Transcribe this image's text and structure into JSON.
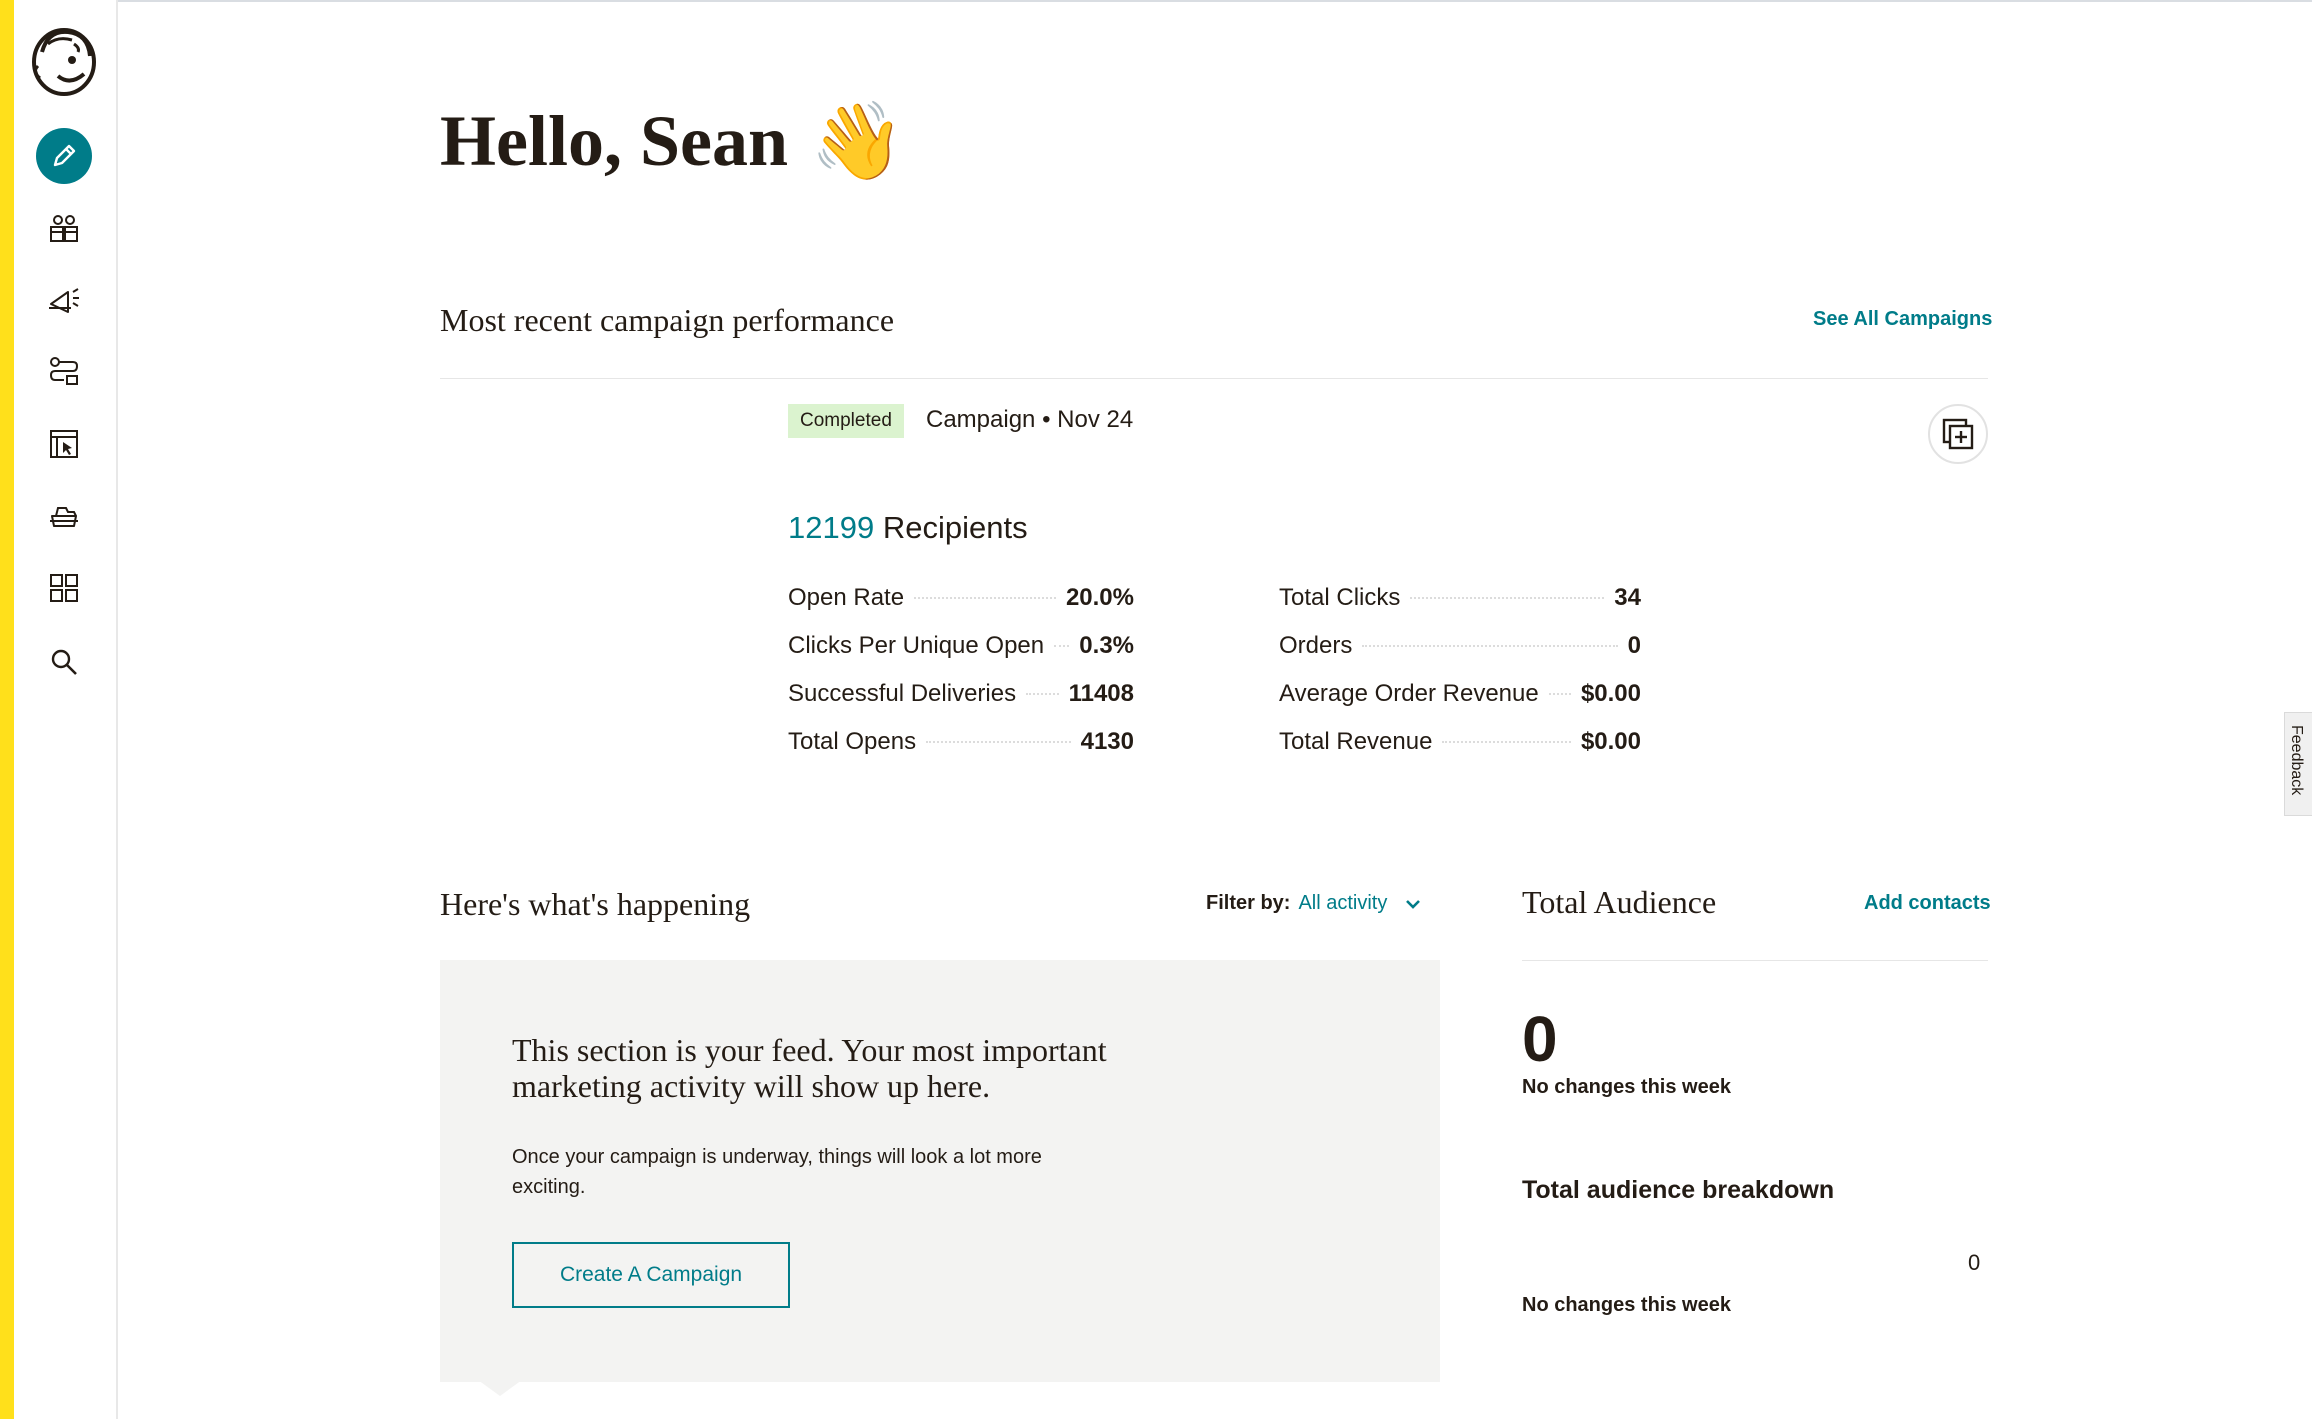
{
  "greeting": {
    "text": "Hello, Sean",
    "emoji": "👋"
  },
  "nav": {
    "items": [
      {
        "name": "create",
        "icon": "pencil-icon",
        "active": true
      },
      {
        "name": "audience",
        "icon": "audience-icon"
      },
      {
        "name": "campaigns",
        "icon": "megaphone-icon"
      },
      {
        "name": "automations",
        "icon": "automation-icon"
      },
      {
        "name": "website",
        "icon": "website-icon"
      },
      {
        "name": "content",
        "icon": "content-studio-icon"
      },
      {
        "name": "integrations",
        "icon": "grid-icon"
      },
      {
        "name": "search",
        "icon": "search-icon"
      }
    ]
  },
  "recent": {
    "title": "Most recent campaign performance",
    "see_all": "See All Campaigns",
    "badge": "Completed",
    "meta": "Campaign • Nov 24",
    "recipients_count": "12199",
    "recipients_label": "Recipients",
    "left_stats": [
      {
        "label": "Open Rate",
        "value": "20.0%"
      },
      {
        "label": "Clicks Per Unique Open",
        "value": "0.3%"
      },
      {
        "label": "Successful Deliveries",
        "value": "11408"
      },
      {
        "label": "Total Opens",
        "value": "4130"
      }
    ],
    "right_stats": [
      {
        "label": "Total Clicks",
        "value": "34"
      },
      {
        "label": "Orders",
        "value": "0"
      },
      {
        "label": "Average Order Revenue",
        "value": "$0.00"
      },
      {
        "label": "Total Revenue",
        "value": "$0.00"
      }
    ]
  },
  "feed": {
    "title": "Here's what's happening",
    "filter_label": "Filter by:",
    "filter_value": "All activity",
    "heading": "This section is your feed. Your most important marketing activity will show up here.",
    "sub": "Once your campaign is underway, things will look a lot more exciting.",
    "button": "Create A Campaign"
  },
  "audience": {
    "title": "Total Audience",
    "add_contacts": "Add contacts",
    "count": "0",
    "changes": "No changes this week",
    "breakdown_title": "Total audience breakdown",
    "breakdown_value": "0",
    "breakdown_changes": "No changes this week"
  },
  "feedback_label": "Feedback",
  "colors": {
    "accent": "#007c89",
    "brand_yellow": "#ffe01b",
    "badge_bg": "#dbf3cf",
    "feed_bg": "#f3f3f2"
  }
}
